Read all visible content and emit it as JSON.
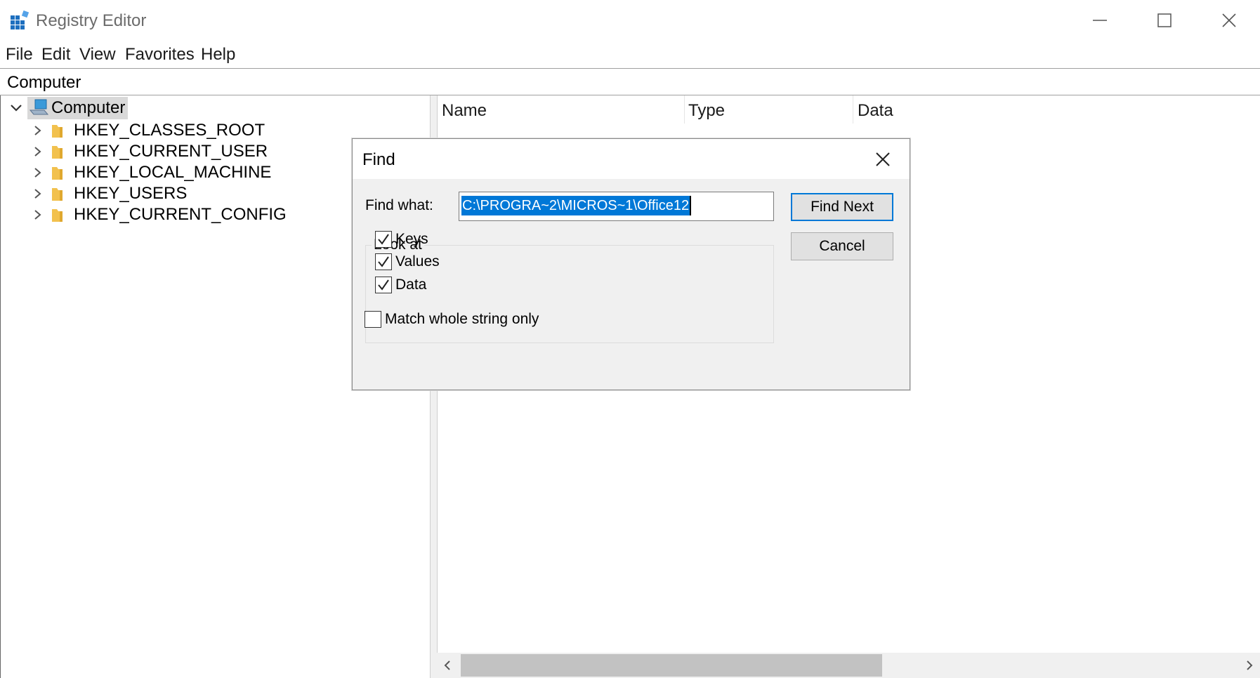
{
  "window": {
    "title": "Registry Editor",
    "controls": [
      "minimize-icon",
      "maximize-icon",
      "close-icon"
    ]
  },
  "menu": {
    "items": [
      "File",
      "Edit",
      "View",
      "Favorites",
      "Help"
    ]
  },
  "address": {
    "value": "Computer"
  },
  "tree": {
    "root": "Computer",
    "items": [
      "HKEY_CLASSES_ROOT",
      "HKEY_CURRENT_USER",
      "HKEY_LOCAL_MACHINE",
      "HKEY_USERS",
      "HKEY_CURRENT_CONFIG"
    ]
  },
  "list": {
    "columns": [
      "Name",
      "Type",
      "Data"
    ]
  },
  "find_dialog": {
    "title": "Find",
    "find_what_label": "Find what:",
    "find_what_value": "C:\\PROGRA~2\\MICROS~1\\Office12",
    "find_next_label": "Find Next",
    "cancel_label": "Cancel",
    "look_at_label": "Look at",
    "options": [
      {
        "label": "Keys",
        "checked": true
      },
      {
        "label": "Values",
        "checked": true
      },
      {
        "label": "Data",
        "checked": true
      }
    ],
    "match_whole": {
      "label": "Match whole string only",
      "checked": false
    }
  },
  "colors": {
    "accent": "#0078d7",
    "folder": "#f2c14e",
    "selection_bg": "#cce8ff"
  }
}
